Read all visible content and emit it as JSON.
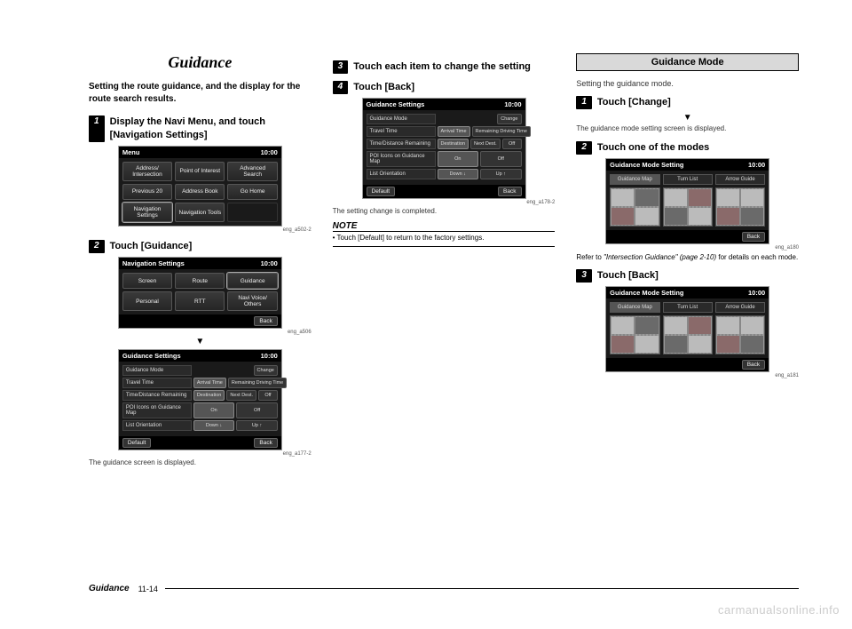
{
  "col1": {
    "title": "Guidance",
    "intro": "Setting the route guidance, and the display for the route search results.",
    "step1": {
      "num": "1",
      "text": "Display the Navi Menu, and touch [Navigation Settings]"
    },
    "screenA": {
      "title": "Menu",
      "time": "10:00",
      "btns": [
        "Address/\nIntersection",
        "Point of\nInterest",
        "Advanced\nSearch",
        "Previous\n20",
        "Address\nBook",
        "Go Home",
        "Navigation\nSettings",
        "Navigation\nTools",
        ""
      ],
      "ref": "eng_a502-2"
    },
    "step2": {
      "num": "2",
      "text": "Touch [Guidance]"
    },
    "screenB": {
      "title": "Navigation Settings",
      "time": "10:00",
      "btns": [
        "Screen",
        "Route",
        "Guidance",
        "Personal",
        "RTT",
        "Navi Voice/\nOthers"
      ],
      "back": "Back",
      "ref": "eng_a506"
    },
    "arrow": "▼",
    "screenC": {
      "title": "Guidance Settings",
      "time": "10:00",
      "rows": [
        {
          "label": "Guidance Mode",
          "vals": [
            "Change"
          ]
        },
        {
          "label": "Travel Time",
          "vals": [
            "Arrival Time",
            "Remaining Driving Time"
          ]
        },
        {
          "label": "Time/Distance Remaining",
          "vals": [
            "Destination",
            "Next Dest.",
            "Off"
          ]
        },
        {
          "label": "POI Icons on Guidance Map",
          "vals": [
            "On",
            "Off"
          ]
        },
        {
          "label": "List Orientation",
          "vals": [
            "Down ↓",
            "Up ↑"
          ]
        }
      ],
      "default": "Default",
      "back": "Back",
      "ref": "eng_a177-2"
    },
    "caption": "The guidance screen is displayed."
  },
  "col2": {
    "step3": {
      "num": "3",
      "text": "Touch each item to change the setting"
    },
    "step4": {
      "num": "4",
      "text": "Touch [Back]"
    },
    "screenD": {
      "title": "Guidance Settings",
      "time": "10:00",
      "rows": [
        {
          "label": "Guidance Mode",
          "vals": [
            "Change"
          ]
        },
        {
          "label": "Travel Time",
          "vals": [
            "Arrival Time",
            "Remaining Driving Time"
          ]
        },
        {
          "label": "Time/Distance Remaining",
          "vals": [
            "Destination",
            "Next Dest.",
            "Off"
          ]
        },
        {
          "label": "POI Icons on Guidance Map",
          "vals": [
            "On",
            "Off"
          ]
        },
        {
          "label": "List Orientation",
          "vals": [
            "Down ↓",
            "Up ↑"
          ]
        }
      ],
      "default": "Default",
      "back": "Back",
      "ref": "eng_a178-2"
    },
    "caption": "The setting change is completed.",
    "noteLabel": "NOTE",
    "noteText": "• Touch [Default] to return to the factory settings."
  },
  "col3": {
    "boxTitle": "Guidance Mode",
    "intro": "Setting the guidance mode.",
    "step1": {
      "num": "1",
      "text": "Touch [Change]"
    },
    "arrow": "▼",
    "caption1": "The guidance mode setting screen is displayed.",
    "step2": {
      "num": "2",
      "text": "Touch one of the modes"
    },
    "screenE": {
      "title": "Guidance Mode Setting",
      "time": "10:00",
      "tabs": [
        "Guidance Map",
        "Turn List",
        "Arrow Guide"
      ],
      "back": "Back",
      "ref": "eng_a180"
    },
    "refer": {
      "pre": "Refer to ",
      "it": "\"Intersection Guidance\" (page 2-10)",
      "post": " for details on each mode."
    },
    "step3": {
      "num": "3",
      "text": "Touch [Back]"
    },
    "screenF": {
      "title": "Guidance Mode Setting",
      "time": "10:00",
      "tabs": [
        "Guidance Map",
        "Turn List",
        "Arrow Guide"
      ],
      "back": "Back",
      "ref": "eng_a181"
    }
  },
  "footer": {
    "title": "Guidance",
    "page": "11-14"
  },
  "watermark": "carmanualsonline.info"
}
